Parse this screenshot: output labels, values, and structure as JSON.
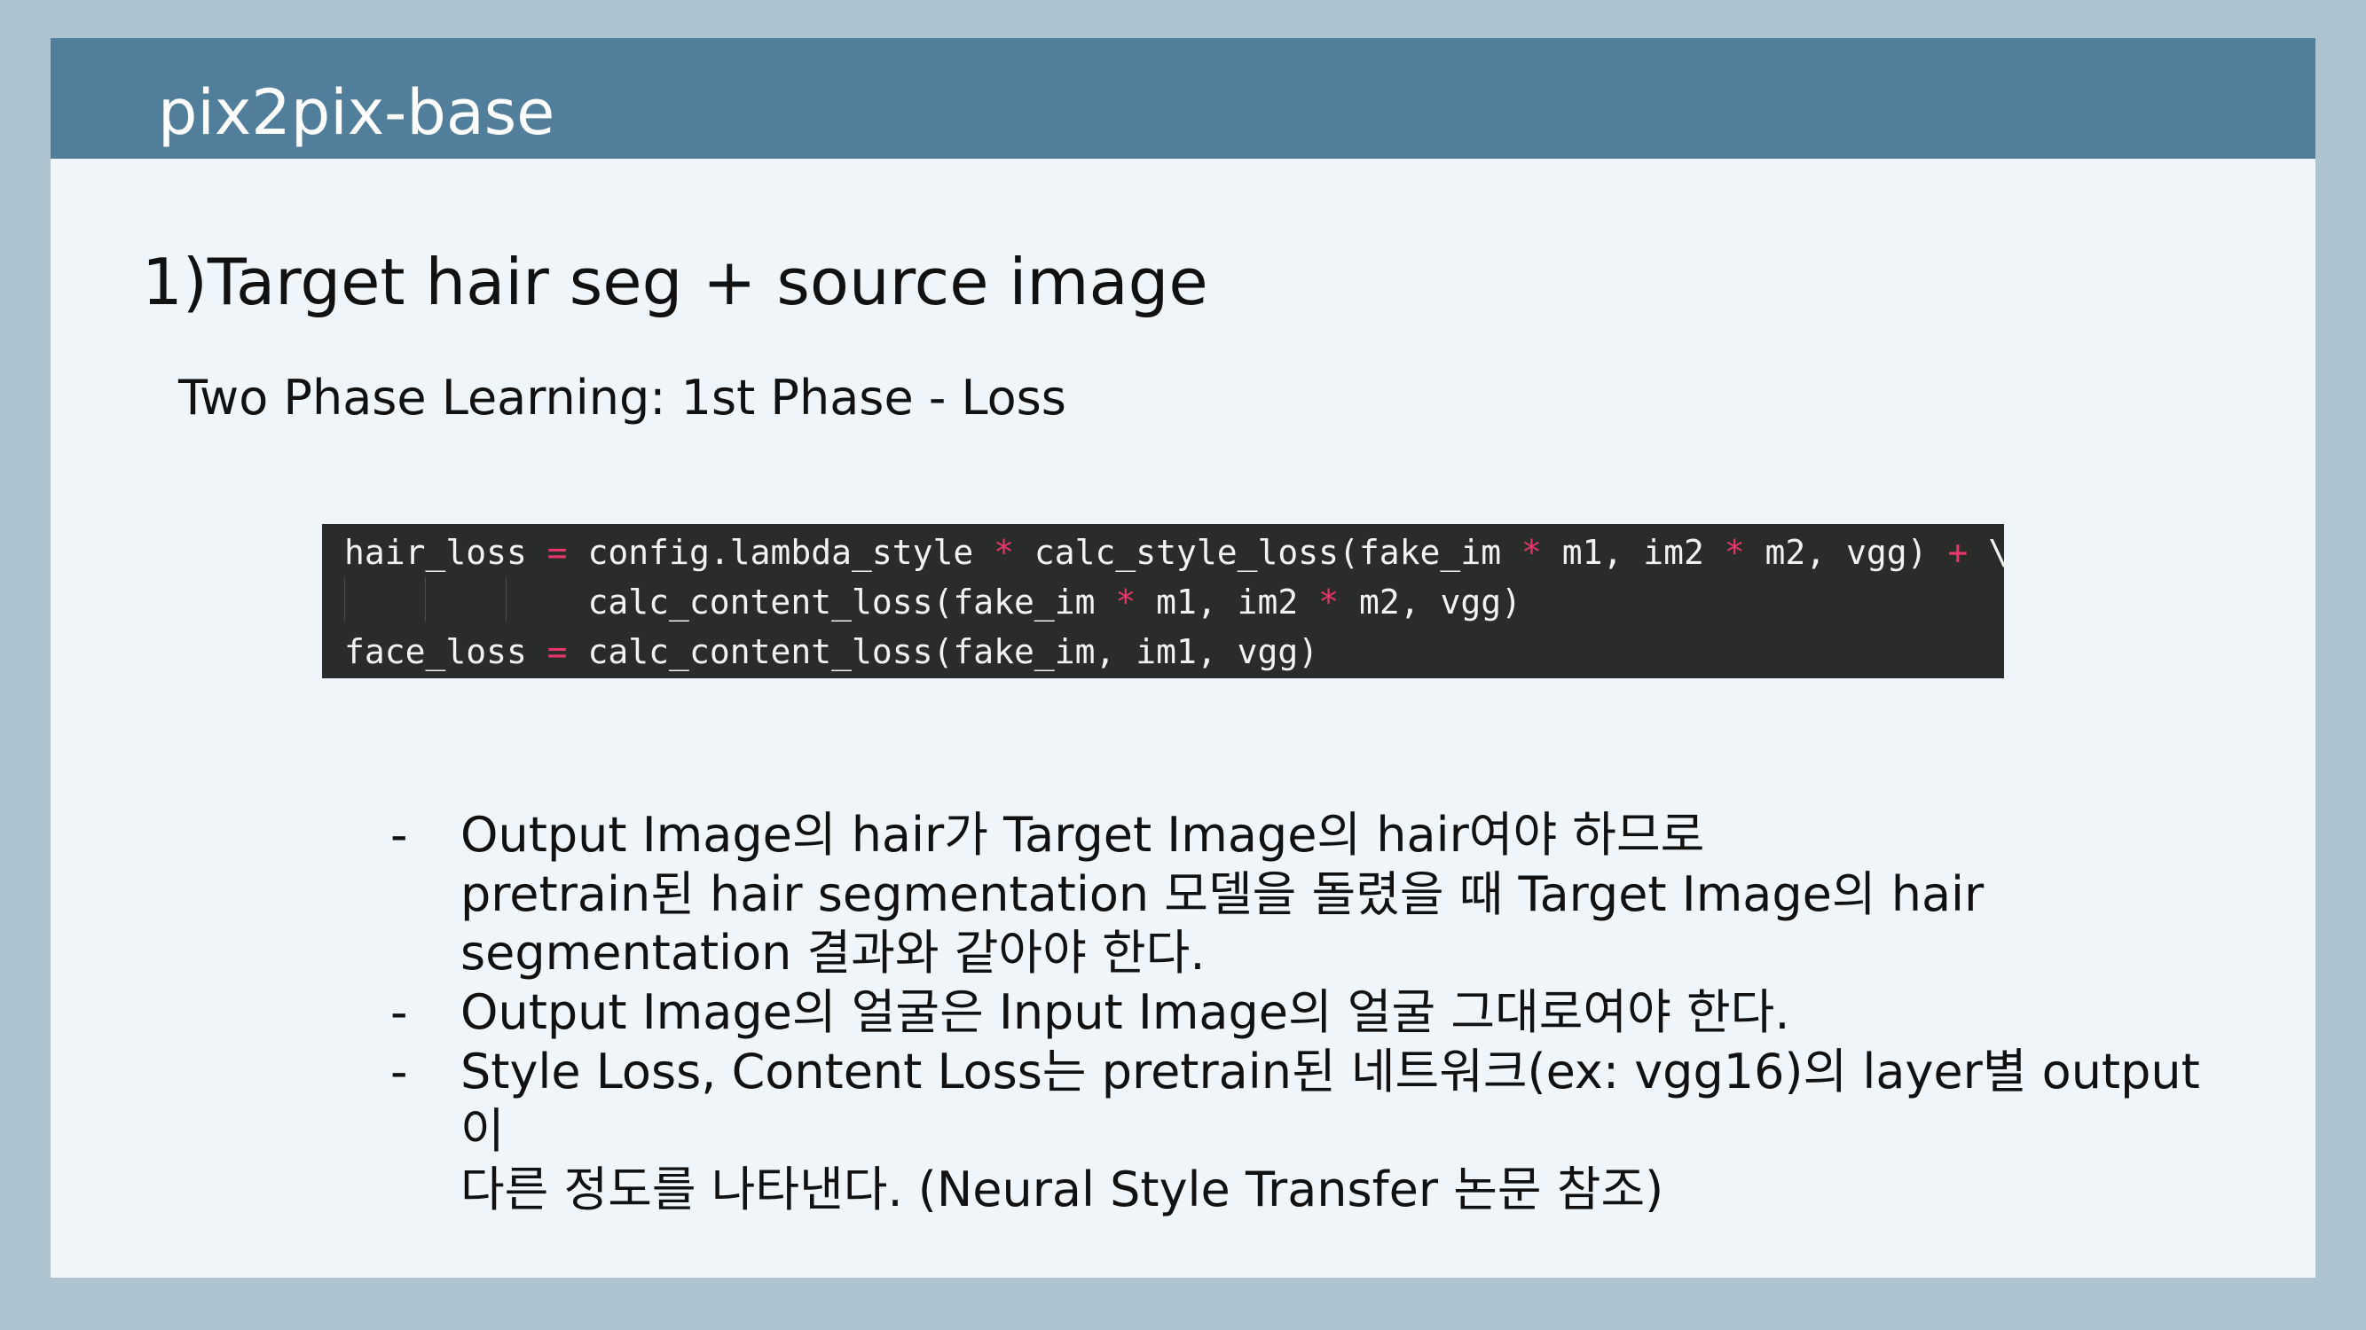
{
  "slide": {
    "title": "pix2pix-base",
    "heading": "1)Target hair seg + source image",
    "subheading": "Two Phase Learning: 1st Phase - Loss"
  },
  "code": {
    "lines": [
      [
        {
          "text": "hair_loss ",
          "type": "plain"
        },
        {
          "text": "=",
          "type": "op"
        },
        {
          "text": " config.lambda_style ",
          "type": "plain"
        },
        {
          "text": "*",
          "type": "op"
        },
        {
          "text": " calc_style_loss(fake_im ",
          "type": "plain"
        },
        {
          "text": "*",
          "type": "op"
        },
        {
          "text": " m1, im2 ",
          "type": "plain"
        },
        {
          "text": "*",
          "type": "op"
        },
        {
          "text": " m2, vgg) ",
          "type": "plain"
        },
        {
          "text": "+",
          "type": "op"
        },
        {
          "text": " \\",
          "type": "plain"
        }
      ],
      [
        {
          "text": "            calc_content_loss(fake_im ",
          "type": "plain"
        },
        {
          "text": "*",
          "type": "op"
        },
        {
          "text": " m1, im2 ",
          "type": "plain"
        },
        {
          "text": "*",
          "type": "op"
        },
        {
          "text": " m2, vgg)",
          "type": "plain"
        }
      ],
      [
        {
          "text": "face_loss ",
          "type": "plain"
        },
        {
          "text": "=",
          "type": "op"
        },
        {
          "text": " calc_content_loss(fake_im, im1, vgg)",
          "type": "plain"
        }
      ]
    ]
  },
  "bullets": [
    {
      "dash": "-",
      "lines": [
        "Output Image의 hair가 Target Image의 hair여야 하므로",
        "pretrain된 hair segmentation 모델을 돌렸을 때 Target Image의 hair",
        "segmentation 결과와 같아야 한다."
      ]
    },
    {
      "dash": "-",
      "lines": [
        "Output Image의 얼굴은 Input Image의 얼굴 그대로여야 한다."
      ]
    },
    {
      "dash": "-",
      "lines": [
        "Style Loss, Content Loss는 pretrain된 네트워크(ex: vgg16)의 layer별 output",
        "이",
        "다른 정도를 나타낸다. (Neural Style Transfer 논문 참조)"
      ]
    }
  ],
  "colors": {
    "background": "#adc3cf",
    "title_bar": "#517e9b",
    "slide": "#f0f5f9",
    "code_background": "#2a2c29",
    "code_text": "#f2f2f2",
    "code_operator": "#e6366b"
  }
}
